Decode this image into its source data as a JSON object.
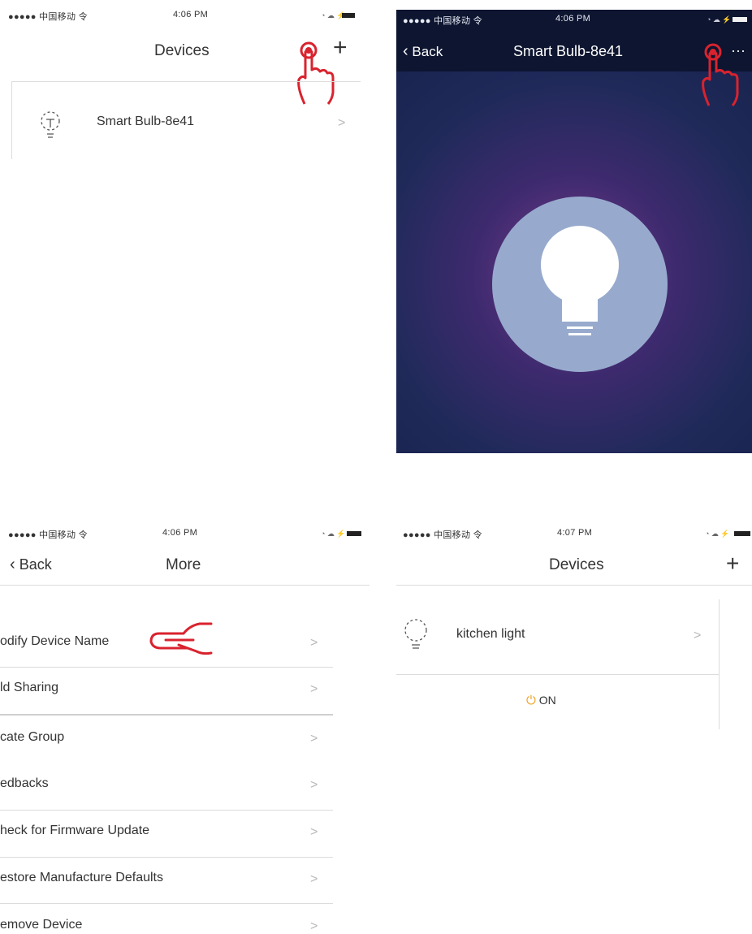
{
  "p1": {
    "status": {
      "carrier": "●●●●● 中国移动 令",
      "time": "4:06 PM"
    },
    "title": "Devices",
    "add_label": "+",
    "device_name": "Smart Bulb-8e41",
    "chevron": ">"
  },
  "p2": {
    "status": {
      "carrier": "●●●●● 中国移动 令",
      "time": "4:06 PM"
    },
    "back_label": "Back",
    "title": "Smart Bulb-8e41",
    "more_label": "···"
  },
  "p3": {
    "status": {
      "carrier": "●●●●● 中国移动 令",
      "time": "4:06 PM"
    },
    "back_label": "Back",
    "title": "More",
    "chevron": ">",
    "items": [
      "odify Device Name",
      "ld Sharing",
      "cate Group",
      "edbacks",
      "heck for Firmware Update",
      "estore Manufacture Defaults",
      "emove Device"
    ]
  },
  "p4": {
    "status": {
      "carrier": "●●●●● 中国移动 令",
      "time": "4:07 PM"
    },
    "title": "Devices",
    "add_label": "+",
    "device_name": "kitchen light",
    "chevron": ">",
    "power_label": "ON"
  },
  "colors": {
    "accent_red": "#d9232e",
    "nav_dark": "#0d1530",
    "bulb_circle": "#97aacd",
    "power_orange": "#f0a020"
  }
}
